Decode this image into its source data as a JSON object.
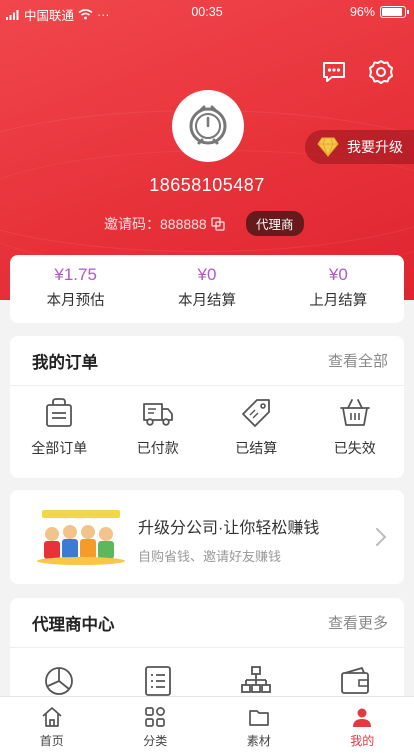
{
  "status_bar": {
    "carrier": "中国联通",
    "dots": "···",
    "time": "00:35",
    "battery": "96%"
  },
  "profile": {
    "phone": "18658105487",
    "invite_label": "邀请码：888888",
    "role_badge": "代理商",
    "upgrade_label": "我要升级"
  },
  "stats": [
    {
      "value": "¥1.75",
      "label": "本月预估"
    },
    {
      "value": "¥0",
      "label": "本月结算"
    },
    {
      "value": "¥0",
      "label": "上月结算"
    }
  ],
  "orders": {
    "title": "我的订单",
    "more": "查看全部",
    "items": [
      {
        "label": "全部订单",
        "icon": "bag-icon"
      },
      {
        "label": "已付款",
        "icon": "truck-icon"
      },
      {
        "label": "已结算",
        "icon": "tag-icon"
      },
      {
        "label": "已失效",
        "icon": "basket-icon"
      }
    ]
  },
  "promo": {
    "title": "升级分公司·让你轻松赚钱",
    "subtitle": "自购省钱、邀请好友赚钱"
  },
  "agent_center": {
    "title": "代理商中心",
    "more": "查看更多",
    "items": [
      {
        "icon": "pie-chart-icon"
      },
      {
        "icon": "list-icon"
      },
      {
        "icon": "org-tree-icon"
      },
      {
        "icon": "wallet-icon"
      }
    ]
  },
  "tabbar": [
    {
      "label": "首页",
      "icon": "home-icon"
    },
    {
      "label": "分类",
      "icon": "grid-icon"
    },
    {
      "label": "素材",
      "icon": "folder-icon"
    },
    {
      "label": "我的",
      "icon": "user-icon",
      "active": true
    }
  ],
  "colors": {
    "brand_red": "#e8323a",
    "stat_purple": "#b05ac4"
  }
}
